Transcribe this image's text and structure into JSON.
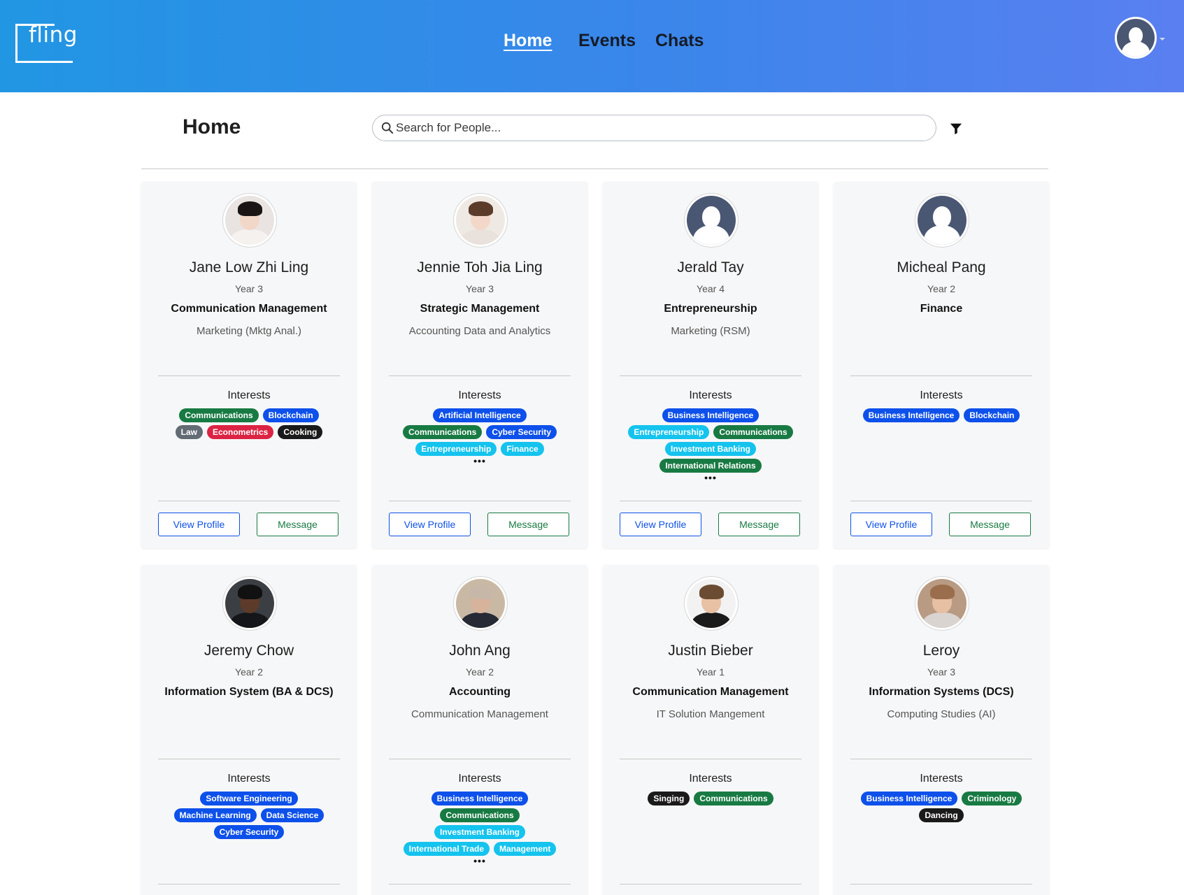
{
  "header": {
    "logo": "fling",
    "nav": [
      {
        "label": "Home",
        "active": true
      },
      {
        "label": "Events",
        "active": false
      },
      {
        "label": "Chats",
        "active": false
      }
    ]
  },
  "page": {
    "title": "Home",
    "search_placeholder": "Search for People..."
  },
  "interests_label": "Interests",
  "buttons": {
    "view_profile": "View Profile",
    "message": "Message"
  },
  "tag_colors": {
    "blue": "#0d50ea",
    "green": "#187a43",
    "cyan": "#14c3ee",
    "gray": "#636b74",
    "red": "#dc2343",
    "black": "#1a1a1a"
  },
  "people": [
    {
      "name": "Jane Low Zhi Ling",
      "year": "Year 3",
      "major": "Communication Management",
      "minor": "Marketing (Mktg Anal.)",
      "avatar": "photo-woman-dark-hair",
      "interests": [
        [
          {
            "label": "Communications",
            "color": "green"
          },
          {
            "label": "Blockchain",
            "color": "blue"
          }
        ],
        [
          {
            "label": "Law",
            "color": "gray"
          },
          {
            "label": "Econometrics",
            "color": "red"
          },
          {
            "label": "Cooking",
            "color": "black"
          }
        ]
      ],
      "more": false
    },
    {
      "name": "Jennie Toh Jia Ling",
      "year": "Year 3",
      "major": "Strategic Management",
      "minor": "Accounting Data and Analytics",
      "avatar": "photo-woman-brown-hair",
      "interests": [
        [
          {
            "label": "Artificial Intelligence",
            "color": "blue"
          }
        ],
        [
          {
            "label": "Communications",
            "color": "green"
          },
          {
            "label": "Cyber Security",
            "color": "blue"
          }
        ],
        [
          {
            "label": "Entrepreneurship",
            "color": "cyan"
          },
          {
            "label": "Finance",
            "color": "cyan"
          }
        ]
      ],
      "more": true
    },
    {
      "name": "Jerald Tay",
      "year": "Year 4",
      "major": "Entrepreneurship",
      "minor": "Marketing (RSM)",
      "avatar": "default-silhouette",
      "interests": [
        [
          {
            "label": "Business Intelligence",
            "color": "blue"
          }
        ],
        [
          {
            "label": "Entrepreneurship",
            "color": "cyan"
          },
          {
            "label": "Communications",
            "color": "green"
          }
        ],
        [
          {
            "label": "Investment Banking",
            "color": "cyan"
          }
        ],
        [
          {
            "label": "International Relations",
            "color": "green"
          }
        ]
      ],
      "more": true
    },
    {
      "name": "Micheal Pang",
      "year": "Year 2",
      "major": "Finance",
      "minor": "",
      "avatar": "default-silhouette",
      "interests": [
        [
          {
            "label": "Business Intelligence",
            "color": "blue"
          },
          {
            "label": "Blockchain",
            "color": "blue"
          }
        ]
      ],
      "more": false
    },
    {
      "name": "Jeremy Chow",
      "year": "Year 2",
      "major": "Information System (BA & DCS)",
      "minor": "",
      "avatar": "photo-man-suit",
      "interests": [
        [
          {
            "label": "Software Engineering",
            "color": "blue"
          }
        ],
        [
          {
            "label": "Machine Learning",
            "color": "blue"
          },
          {
            "label": "Data Science",
            "color": "blue"
          }
        ],
        [
          {
            "label": "Cyber Security",
            "color": "blue"
          }
        ]
      ],
      "more": false
    },
    {
      "name": "John Ang",
      "year": "Year 2",
      "major": "Accounting",
      "minor": "Communication Management",
      "avatar": "photo-man-older-suit",
      "interests": [
        [
          {
            "label": "Business Intelligence",
            "color": "blue"
          }
        ],
        [
          {
            "label": "Communications",
            "color": "green"
          }
        ],
        [
          {
            "label": "Investment Banking",
            "color": "cyan"
          }
        ],
        [
          {
            "label": "International Trade",
            "color": "cyan"
          },
          {
            "label": "Management",
            "color": "cyan"
          }
        ]
      ],
      "more": true
    },
    {
      "name": "Justin Bieber",
      "year": "Year 1",
      "major": "Communication Management",
      "minor": "IT Solution Mangement",
      "avatar": "photo-man-young-suit",
      "interests": [
        [
          {
            "label": "Singing",
            "color": "black"
          },
          {
            "label": "Communications",
            "color": "green"
          }
        ]
      ],
      "more": false
    },
    {
      "name": "Leroy",
      "year": "Year 3",
      "major": "Information Systems (DCS)",
      "minor": "Computing Studies (AI)",
      "avatar": "photo-man-smiling",
      "interests": [
        [
          {
            "label": "Business Intelligence",
            "color": "blue"
          },
          {
            "label": "Criminology",
            "color": "green"
          }
        ],
        [
          {
            "label": "Dancing",
            "color": "black"
          }
        ]
      ],
      "more": false
    }
  ]
}
